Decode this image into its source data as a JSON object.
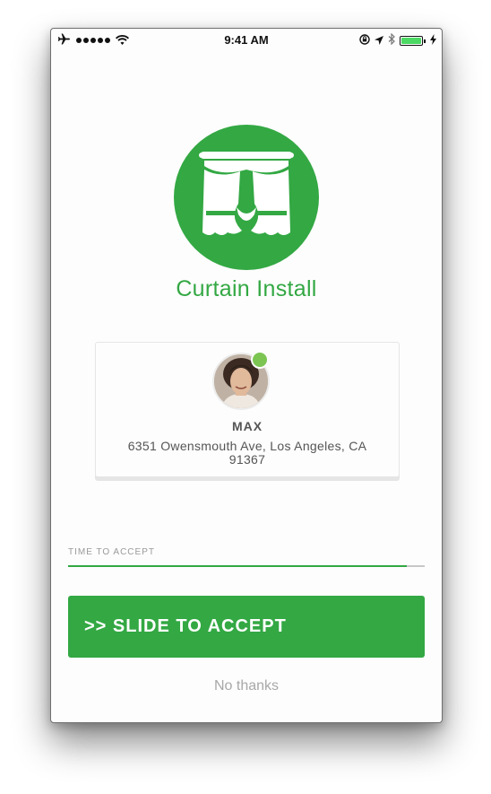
{
  "status_bar": {
    "time": "9:41 AM",
    "icons": [
      "airplane-icon",
      "signal-dots-icon",
      "wifi-icon",
      "rotation-lock-icon",
      "location-arrow-icon",
      "bluetooth-icon",
      "battery-icon",
      "charging-icon"
    ],
    "signal_bars": 5
  },
  "service": {
    "title": "Curtain Install",
    "icon": "curtain-icon"
  },
  "customer": {
    "name": "MAX",
    "address": "6351 Owensmouth Ave, Los Angeles, CA 91367",
    "online": true
  },
  "timer": {
    "label": "TIME TO ACCEPT",
    "progress": 0.95
  },
  "actions": {
    "accept_label": ">> SLIDE TO ACCEPT",
    "decline_label": "No thanks"
  },
  "colors": {
    "brand_green": "#33a843",
    "online_green": "#7cc553",
    "text_gray": "#555555",
    "muted_gray": "#a8a8a8"
  }
}
